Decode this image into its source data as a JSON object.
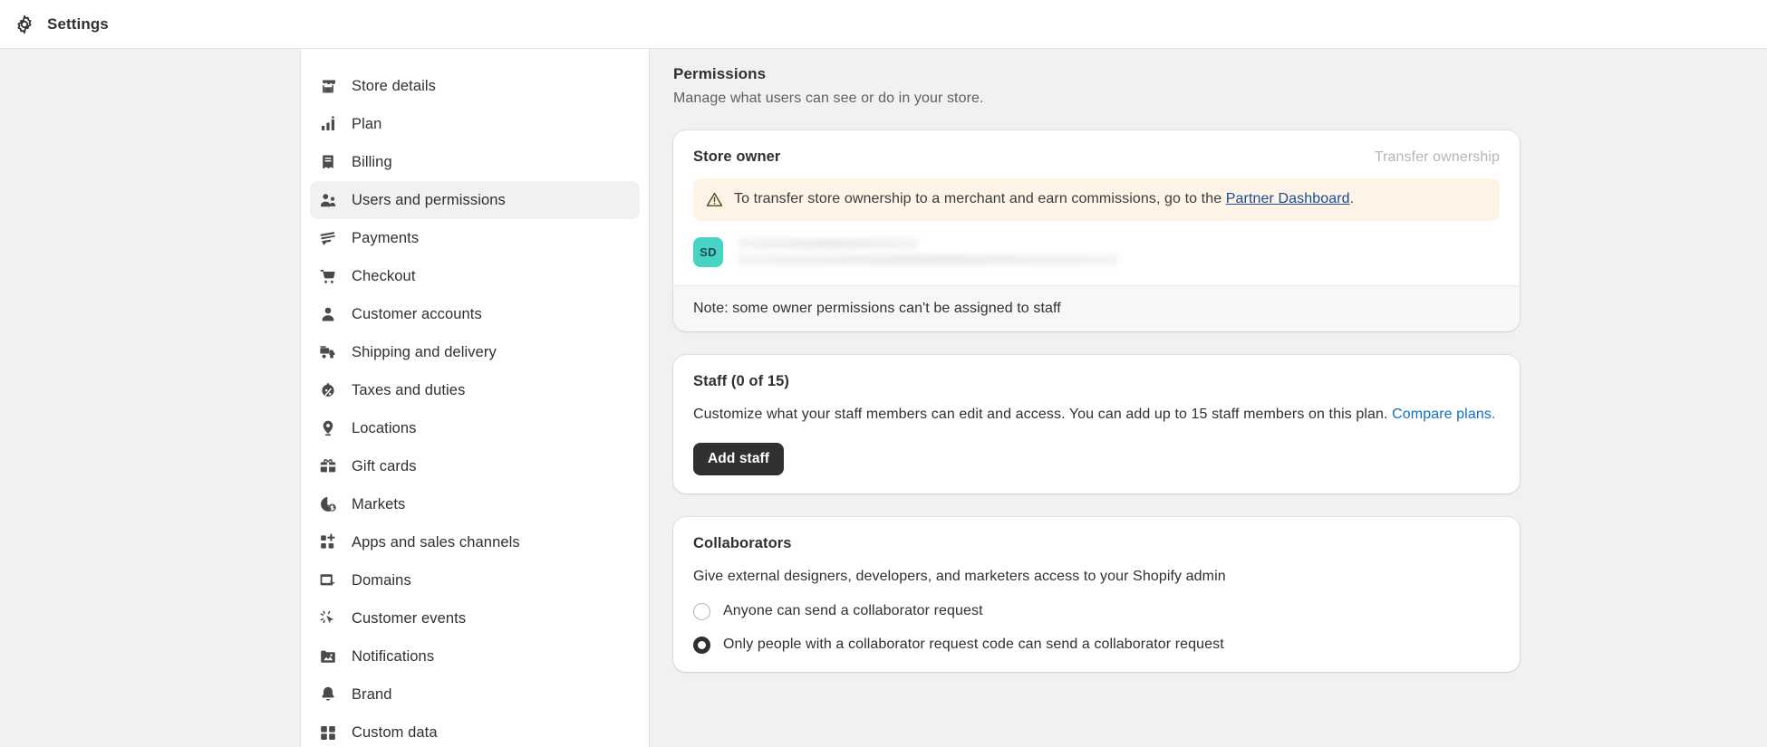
{
  "topbar": {
    "icon": "gear-icon",
    "title": "Settings"
  },
  "sidebar": {
    "items": [
      {
        "icon": "store-icon",
        "label": "Store details",
        "active": false
      },
      {
        "icon": "chart-bar-icon",
        "label": "Plan",
        "active": false
      },
      {
        "icon": "billing-receipt-icon",
        "label": "Billing",
        "active": false
      },
      {
        "icon": "users-icon",
        "label": "Users and permissions",
        "active": true
      },
      {
        "icon": "payments-icon",
        "label": "Payments",
        "active": false
      },
      {
        "icon": "cart-icon",
        "label": "Checkout",
        "active": false
      },
      {
        "icon": "person-icon",
        "label": "Customer accounts",
        "active": false
      },
      {
        "icon": "truck-icon",
        "label": "Shipping and delivery",
        "active": false
      },
      {
        "icon": "tax-icon",
        "label": "Taxes and duties",
        "active": false
      },
      {
        "icon": "location-pin-icon",
        "label": "Locations",
        "active": false
      },
      {
        "icon": "gift-card-icon",
        "label": "Gift cards",
        "active": false
      },
      {
        "icon": "globe-money-icon",
        "label": "Markets",
        "active": false
      },
      {
        "icon": "apps-grid-icon",
        "label": "Apps and sales channels",
        "active": false
      },
      {
        "icon": "domains-icon",
        "label": "Domains",
        "active": false
      },
      {
        "icon": "cursor-click-icon",
        "label": "Customer events",
        "active": false
      },
      {
        "icon": "brand-image-icon",
        "label": "Notifications",
        "active": false
      },
      {
        "icon": "bell-icon",
        "label": "Brand",
        "active": false
      },
      {
        "icon": "custom-data-icon",
        "label": "Custom data",
        "active": false
      }
    ]
  },
  "main": {
    "page_title": "Permissions",
    "page_subtitle": "Manage what users can see or do in your store.",
    "store_owner": {
      "title": "Store owner",
      "transfer_label": "Transfer ownership",
      "banner": {
        "icon": "warning-icon",
        "text_before": "To transfer store ownership to a merchant and earn commissions, go to the ",
        "link_text": "Partner Dashboard",
        "text_after": "."
      },
      "avatar_initials": "SD",
      "footer_note": "Note: some owner permissions can't be assigned to staff"
    },
    "staff": {
      "title": "Staff (0 of 15)",
      "description": "Customize what your staff members can edit and access. You can add up to 15 staff members on this plan.",
      "link_text": "Compare plans.",
      "add_staff_label": "Add staff"
    },
    "collaborators": {
      "title": "Collaborators",
      "description": "Give external designers, developers, and marketers access to your Shopify admin",
      "options": [
        {
          "label": "Anyone can send a collaborator request",
          "selected": false
        },
        {
          "label": "Only people with a collaborator request code can send a collaborator request",
          "selected": true
        }
      ]
    }
  },
  "colors": {
    "page_bg": "#f1f1f1",
    "card_bg": "#ffffff",
    "text": "#303030",
    "muted_text": "#616161",
    "banner_bg": "#fdf3e7",
    "link": "#0f6fc5",
    "banner_link": "#1a4b8f",
    "avatar_bg": "#47d4c4",
    "primary_button_bg": "#303030"
  }
}
